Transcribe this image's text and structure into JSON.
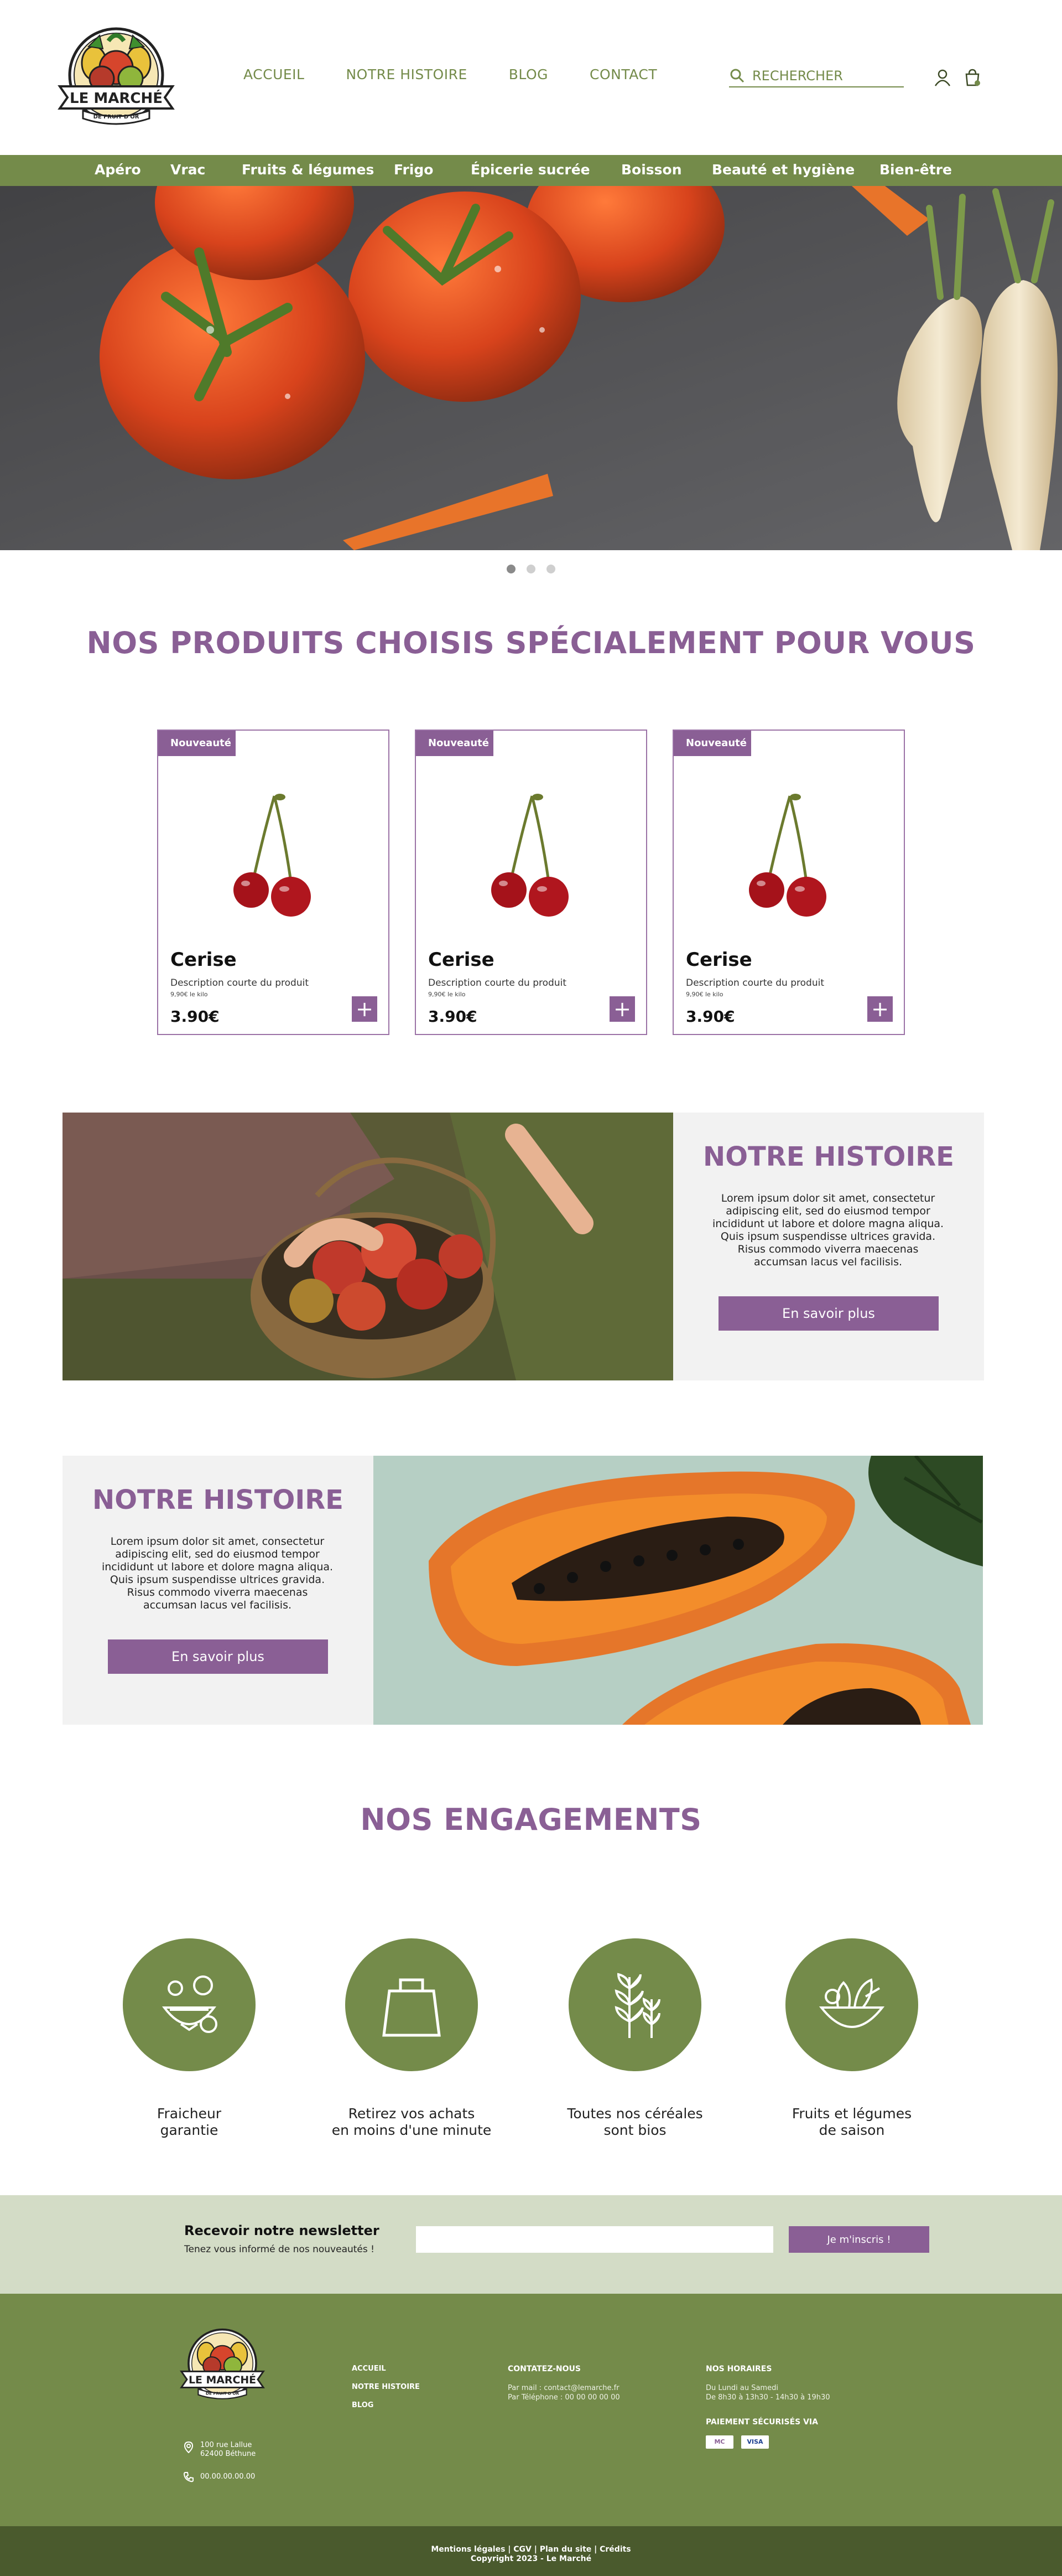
{
  "brand": {
    "name": "LE MARCHÉ",
    "tagline": "DE FRUIT D'OR"
  },
  "nav": {
    "items": [
      "ACCUEIL",
      "NOTRE HISTOIRE",
      "BLOG",
      "CONTACT"
    ],
    "search_placeholder": "RECHERCHER",
    "icons": [
      "search-icon",
      "user-icon",
      "cart-icon"
    ]
  },
  "categories": [
    "Apéro",
    "Vrac",
    "Fruits & légumes",
    "Frigo",
    "Épicerie sucrée",
    "Boisson",
    "Beauté et hygiène",
    "Bien-être"
  ],
  "hero": {
    "slides": 3,
    "active_slide": 1
  },
  "products_section": {
    "title": "NOS PRODUITS CHOISIS SPÉCIALEMENT POUR VOUS",
    "cards": [
      {
        "badge": "Nouveauté",
        "name": "Cerise",
        "description": "Description courte du produit",
        "unit_price": "9,90€ le kilo",
        "price": "3.90€",
        "add_label": "+"
      },
      {
        "badge": "Nouveauté",
        "name": "Cerise",
        "description": "Description courte du produit",
        "unit_price": "9,90€ le kilo",
        "price": "3.90€",
        "add_label": "+"
      },
      {
        "badge": "Nouveauté",
        "name": "Cerise",
        "description": "Description courte du produit",
        "unit_price": "9,90€ le kilo",
        "price": "3.90€",
        "add_label": "+"
      }
    ]
  },
  "story_1": {
    "title": "NOTRE HISTOIRE",
    "text": "Lorem ipsum dolor sit amet, consectetur adipiscing elit, sed do eiusmod tempor incididunt ut labore et dolore magna aliqua. Quis ipsum suspendisse ultrices gravida. Risus commodo viverra maecenas accumsan lacus vel facilisis.",
    "button": "En savoir plus"
  },
  "story_2": {
    "title": "NOTRE HISTOIRE",
    "text": "Lorem ipsum dolor sit amet, consectetur adipiscing elit, sed do eiusmod tempor incididunt ut labore et dolore magna aliqua. Quis ipsum suspendisse ultrices gravida. Risus commodo viverra maecenas accumsan lacus vel facilisis.",
    "button": "En savoir plus"
  },
  "engagements": {
    "title": "NOS ENGAGEMENTS",
    "items": [
      {
        "label": "Fraicheur\ngarantie",
        "icon": "fruits-icon"
      },
      {
        "label": "Retirez vos achats\nen moins d'une minute",
        "icon": "shopping-bag-icon"
      },
      {
        "label": "Toutes nos céréales\nsont bios",
        "icon": "wheat-icon"
      },
      {
        "label": "Fruits et légumes\nde saison",
        "icon": "vegetable-bowl-icon"
      }
    ]
  },
  "newsletter": {
    "title": "Recevoir notre newsletter",
    "subtitle": "Tenez vous informé de nos nouveautés !",
    "button": "Je m'inscris !"
  },
  "footer": {
    "address_1": "100 rue Lallue",
    "address_2": "62400 Béthune",
    "phone": "00.00.00.00.00",
    "links": [
      "ACCUEIL",
      "NOTRE HISTOIRE",
      "BLOG"
    ],
    "contact_title": "CONTATEZ-NOUS",
    "contact_mail": "Par mail : contact@lemarche.fr",
    "contact_phone": "Par Téléphone : 00 00 00 00 00",
    "hours_title": "NOS HORAIRES",
    "hours_days": "Du Lundi au Samedi",
    "hours_times": "De 8h30 à 13h30 - 14h30 à 19h30",
    "payment_title": "PAIEMENT SÉCURISÉS VIA",
    "payment_methods": [
      "MC",
      "VISA"
    ],
    "legal": "Mentions légales | CGV | Plan du site | Crédits",
    "copyright": "Copyright 2023 - Le Marché"
  },
  "colors": {
    "green": "#748b4a",
    "purple": "#8a5f95",
    "light_green": "#d3dcc6",
    "dark_green": "#4a5a2d"
  }
}
